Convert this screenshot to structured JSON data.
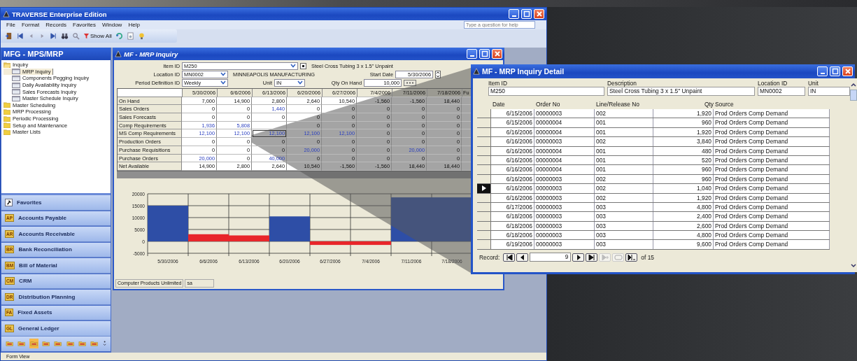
{
  "app_window": {
    "title": "TRAVERSE Enterprise Edition",
    "menu": [
      "File",
      "Format",
      "Records",
      "Favorites",
      "Window",
      "Help"
    ],
    "help_search": {
      "placeholder": "Type a question for help"
    },
    "show_all": "Show All",
    "status_bar": "Form View"
  },
  "nav": {
    "title": "MFG - MPS/MRP",
    "tree": [
      {
        "label": "Inquiry",
        "expanded": true,
        "children": [
          {
            "label": "MRP Inquiry",
            "selected": true
          },
          {
            "label": "Components Pegging Inquiry",
            "selected": false
          },
          {
            "label": "Daily Availability Inquiry",
            "selected": false
          },
          {
            "label": "Sales Forecasts Inquiry",
            "selected": false
          },
          {
            "label": "Master Schedule Inquiry",
            "selected": false
          }
        ]
      },
      {
        "label": "Master Scheduling",
        "expanded": false
      },
      {
        "label": "MRP Processing",
        "expanded": false
      },
      {
        "label": "Periodic Processing",
        "expanded": false
      },
      {
        "label": "Setup and Maintenance",
        "expanded": false
      },
      {
        "label": "Master Lists",
        "expanded": false
      }
    ],
    "modules": [
      {
        "kind": "favorites",
        "label": "Favorites"
      },
      {
        "kind": "module",
        "badge": "AP",
        "label": "Accounts Payable"
      },
      {
        "kind": "module",
        "badge": "AR",
        "label": "Accounts Receivable"
      },
      {
        "kind": "module",
        "badge": "BR",
        "label": "Bank Reconciliation"
      },
      {
        "kind": "module",
        "badge": "BM",
        "label": "Bill of Material"
      },
      {
        "kind": "module",
        "badge": "CM",
        "label": "CRM"
      },
      {
        "kind": "module",
        "badge": "DR",
        "label": "Distribution Planning"
      },
      {
        "kind": "module",
        "badge": "FA",
        "label": "Fixed Assets"
      },
      {
        "kind": "module",
        "badge": "GL",
        "label": "General Ledger"
      }
    ],
    "module_icons": [
      {
        "selected": false
      },
      {
        "selected": false
      },
      {
        "selected": true
      },
      {
        "selected": false
      },
      {
        "selected": false
      },
      {
        "selected": false
      },
      {
        "selected": false
      },
      {
        "selected": false
      }
    ]
  },
  "mrp_inquiry": {
    "title": "MF - MRP Inquiry",
    "item_id": {
      "label": "Item ID",
      "value": "M250"
    },
    "item_description": "Steel Cross Tubing 3 x 1.5\" Unpaint",
    "location_id": {
      "label": "Location ID",
      "value": "MN0002"
    },
    "location_name": "MINNEAPOLIS MANUFACTURING",
    "start_date": {
      "label": "Start Date",
      "value": "5/30/2006"
    },
    "period_definition_id": {
      "label": "Period Definition ID",
      "value": "Weekly"
    },
    "unit": {
      "label": "Unit",
      "value": "IN"
    },
    "qty_on_hand": {
      "label": "Qty On Hand",
      "value": "10,000"
    },
    "grid": {
      "columns": [
        "5/30/2006",
        "6/6/2006",
        "6/13/2006",
        "6/20/2006",
        "6/27/2006",
        "7/4/2006",
        "7/11/2006",
        "7/18/2006",
        "Fu"
      ],
      "rows": [
        {
          "label": "On Hand",
          "cells": [
            {
              "value": "7,000",
              "linked": false,
              "selected": false
            },
            {
              "value": "14,900",
              "linked": false,
              "selected": false
            },
            {
              "value": "2,800",
              "linked": false,
              "selected": false
            },
            {
              "value": "2,640",
              "linked": false,
              "selected": false
            },
            {
              "value": "10,540",
              "linked": false,
              "selected": false
            },
            {
              "value": "-1,560",
              "linked": false,
              "selected": false
            },
            {
              "value": "-1,560",
              "linked": false,
              "selected": false
            },
            {
              "value": "18,440",
              "linked": false,
              "selected": false
            }
          ]
        },
        {
          "label": "Sales Orders",
          "cells": [
            {
              "value": "0",
              "linked": false,
              "selected": false
            },
            {
              "value": "0",
              "linked": false,
              "selected": false
            },
            {
              "value": "1,440",
              "linked": true,
              "selected": false
            },
            {
              "value": "0",
              "linked": false,
              "selected": false
            },
            {
              "value": "0",
              "linked": false,
              "selected": false
            },
            {
              "value": "0",
              "linked": false,
              "selected": false
            },
            {
              "value": "0",
              "linked": false,
              "selected": false
            },
            {
              "value": "0",
              "linked": false,
              "selected": false
            }
          ]
        },
        {
          "label": "Sales Forecasts",
          "cells": [
            {
              "value": "0",
              "linked": false,
              "selected": false
            },
            {
              "value": "0",
              "linked": false,
              "selected": false
            },
            {
              "value": "0",
              "linked": false,
              "selected": false
            },
            {
              "value": "0",
              "linked": false,
              "selected": false
            },
            {
              "value": "0",
              "linked": false,
              "selected": false
            },
            {
              "value": "0",
              "linked": false,
              "selected": false
            },
            {
              "value": "0",
              "linked": false,
              "selected": false
            },
            {
              "value": "0",
              "linked": false,
              "selected": false
            }
          ]
        },
        {
          "label": "Comp Requirements",
          "cells": [
            {
              "value": "1,936",
              "linked": true,
              "selected": false
            },
            {
              "value": "5,808",
              "linked": true,
              "selected": false
            },
            {
              "selected": false
            },
            {
              "value": "0",
              "linked": false,
              "selected": false
            },
            {
              "value": "0",
              "linked": false,
              "selected": false
            },
            {
              "value": "0",
              "linked": false,
              "selected": false
            },
            {
              "value": "0",
              "linked": false,
              "selected": false
            },
            {
              "value": "0",
              "linked": false,
              "selected": false
            }
          ]
        },
        {
          "label": "MS Comp Requirements",
          "cells": [
            {
              "value": "12,100",
              "linked": true,
              "selected": false
            },
            {
              "value": "12,100",
              "linked": true,
              "selected": false
            },
            {
              "value": "12,100",
              "linked": true,
              "selected": true
            },
            {
              "value": "12,100",
              "linked": true,
              "selected": false
            },
            {
              "value": "12,100",
              "linked": true,
              "selected": false
            },
            {
              "value": "0",
              "linked": false,
              "selected": false
            },
            {
              "value": "0",
              "linked": false,
              "selected": false
            },
            {
              "value": "0",
              "linked": false,
              "selected": false
            }
          ]
        },
        {
          "label": "Production Orders",
          "cells": [
            {
              "value": "0",
              "linked": false,
              "selected": false
            },
            {
              "value": "0",
              "linked": false,
              "selected": false
            },
            {
              "value": "0",
              "linked": false,
              "selected": false
            },
            {
              "value": "0",
              "linked": false,
              "selected": false
            },
            {
              "value": "0",
              "linked": false,
              "selected": false
            },
            {
              "value": "0",
              "linked": false,
              "selected": false
            },
            {
              "value": "0",
              "linked": false,
              "selected": false
            },
            {
              "value": "0",
              "linked": false,
              "selected": false
            }
          ]
        },
        {
          "label": "Purchase Requisitions",
          "cells": [
            {
              "value": "0",
              "linked": false,
              "selected": false
            },
            {
              "value": "0",
              "linked": false,
              "selected": false
            },
            {
              "value": "0",
              "linked": false,
              "selected": false
            },
            {
              "value": "20,000",
              "linked": true,
              "selected": false
            },
            {
              "value": "0",
              "linked": false,
              "selected": false
            },
            {
              "value": "0",
              "linked": false,
              "selected": false
            },
            {
              "value": "20,000",
              "linked": true,
              "selected": false
            },
            {
              "value": "0",
              "linked": false,
              "selected": false
            }
          ]
        },
        {
          "label": "Purchase Orders",
          "cells": [
            {
              "value": "20,000",
              "linked": true,
              "selected": false
            },
            {
              "value": "0",
              "linked": false,
              "selected": false
            },
            {
              "value": "40,000",
              "linked": true,
              "selected": false
            },
            {
              "value": "0",
              "linked": false,
              "selected": false
            },
            {
              "value": "0",
              "linked": false,
              "selected": false
            },
            {
              "value": "0",
              "linked": false,
              "selected": false
            },
            {
              "value": "0",
              "linked": false,
              "selected": false
            },
            {
              "value": "0",
              "linked": false,
              "selected": false
            }
          ]
        },
        {
          "label": "Net Available",
          "cells": [
            {
              "value": "14,900",
              "linked": false,
              "selected": false
            },
            {
              "value": "2,800",
              "linked": false,
              "selected": false
            },
            {
              "value": "2,640",
              "linked": false,
              "selected": false
            },
            {
              "value": "10,540",
              "linked": false,
              "selected": false
            },
            {
              "value": "-1,560",
              "linked": false,
              "selected": false
            },
            {
              "value": "-1,560",
              "linked": false,
              "selected": false
            },
            {
              "value": "18,440",
              "linked": false,
              "selected": false
            },
            {
              "value": "18,440",
              "linked": false,
              "selected": false
            }
          ]
        }
      ]
    },
    "chart_data": {
      "type": "bar",
      "categories": [
        "5/30/2006",
        "6/6/2006",
        "6/13/2006",
        "6/20/2006",
        "6/27/2006",
        "7/4/2006",
        "7/11/2006",
        "7/18/2006"
      ],
      "series": [
        {
          "color": "#2e4ea6",
          "values": [
            15000,
            null,
            null,
            10500,
            null,
            null,
            18500,
            18500
          ]
        },
        {
          "color": "#e8262a",
          "values": [
            null,
            3000,
            2500,
            null,
            -1500,
            -1500,
            null,
            null
          ]
        }
      ],
      "grid": true,
      "ylim": [
        -5000,
        20000
      ],
      "yticks": [
        -5000,
        0,
        5000,
        10000,
        15000,
        20000
      ]
    },
    "status": {
      "company": "Computer Products Unlimited",
      "user": "sa"
    }
  },
  "detail": {
    "title": "MF - MRP Inquiry Detail",
    "header": [
      {
        "label": "Item ID",
        "value": "M250"
      },
      {
        "label": "Description",
        "value": "Steel Cross Tubing 3 x 1.5\" Unpaint"
      },
      {
        "label": "Location ID",
        "value": "MN0002"
      },
      {
        "label": "Unit",
        "value": "IN"
      }
    ],
    "columns": [
      "Date",
      "Order No",
      "Line/Release No",
      "Qty",
      "Source"
    ],
    "rows": [
      {
        "date": "6/15/2006",
        "order_no": "00000003",
        "line": "002",
        "qty": "1,920",
        "source": "Prod Orders Comp Demand",
        "selected": false
      },
      {
        "date": "6/15/2006",
        "order_no": "00000004",
        "line": "001",
        "qty": "960",
        "source": "Prod Orders Comp Demand",
        "selected": false
      },
      {
        "date": "6/16/2006",
        "order_no": "00000004",
        "line": "001",
        "qty": "1,920",
        "source": "Prod Orders Comp Demand",
        "selected": false
      },
      {
        "date": "6/16/2006",
        "order_no": "00000003",
        "line": "002",
        "qty": "3,840",
        "source": "Prod Orders Comp Demand",
        "selected": false
      },
      {
        "date": "6/16/2006",
        "order_no": "00000004",
        "line": "001",
        "qty": "480",
        "source": "Prod Orders Comp Demand",
        "selected": false
      },
      {
        "date": "6/16/2006",
        "order_no": "00000004",
        "line": "001",
        "qty": "520",
        "source": "Prod Orders Comp Demand",
        "selected": false
      },
      {
        "date": "6/16/2006",
        "order_no": "00000004",
        "line": "001",
        "qty": "960",
        "source": "Prod Orders Comp Demand",
        "selected": false
      },
      {
        "date": "6/16/2006",
        "order_no": "00000003",
        "line": "002",
        "qty": "960",
        "source": "Prod Orders Comp Demand",
        "selected": false
      },
      {
        "date": "6/16/2006",
        "order_no": "00000003",
        "line": "002",
        "qty": "1,040",
        "source": "Prod Orders Comp Demand",
        "selected": true
      },
      {
        "date": "6/16/2006",
        "order_no": "00000003",
        "line": "002",
        "qty": "1,920",
        "source": "Prod Orders Comp Demand",
        "selected": false
      },
      {
        "date": "6/17/2006",
        "order_no": "00000003",
        "line": "003",
        "qty": "4,800",
        "source": "Prod Orders Comp Demand",
        "selected": false
      },
      {
        "date": "6/18/2006",
        "order_no": "00000003",
        "line": "003",
        "qty": "2,400",
        "source": "Prod Orders Comp Demand",
        "selected": false
      },
      {
        "date": "6/18/2006",
        "order_no": "00000003",
        "line": "003",
        "qty": "2,600",
        "source": "Prod Orders Comp Demand",
        "selected": false
      },
      {
        "date": "6/18/2006",
        "order_no": "00000003",
        "line": "003",
        "qty": "4,800",
        "source": "Prod Orders Comp Demand",
        "selected": false
      },
      {
        "date": "6/19/2006",
        "order_no": "00000003",
        "line": "003",
        "qty": "9,600",
        "source": "Prod Orders Comp Demand",
        "selected": false
      }
    ],
    "record_nav": {
      "label": "Record:",
      "current": "9",
      "total": "of 15"
    }
  }
}
